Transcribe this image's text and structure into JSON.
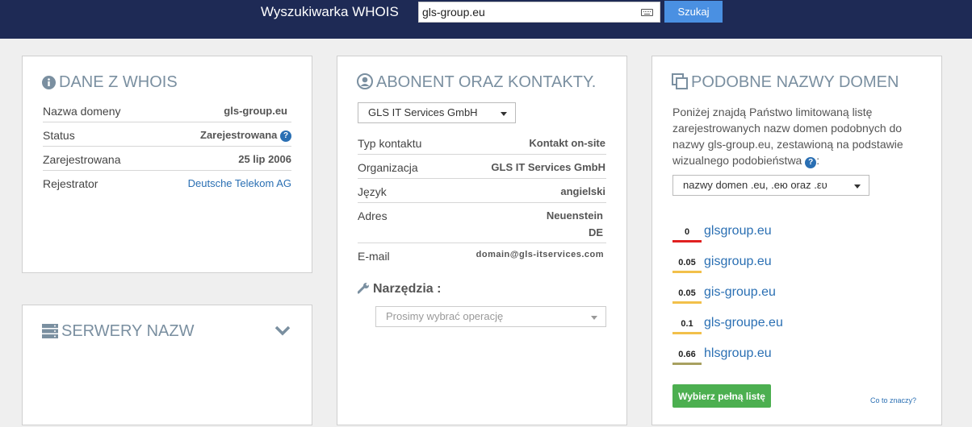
{
  "header": {
    "title": "Wyszukiwarka WHOIS",
    "search_value": "gls-group.eu",
    "search_button": "Szukaj"
  },
  "whois": {
    "title": "DANE Z WHOIS",
    "rows": [
      {
        "label": "Nazwa domeny",
        "value": "gls-group.eu"
      },
      {
        "label": "Status",
        "value": "Zarejestrowana"
      },
      {
        "label": "Zarejestrowana",
        "value": "25 lip 2006"
      },
      {
        "label": "Rejestrator",
        "value": "Deutsche Telekom AG"
      }
    ]
  },
  "servers": {
    "title": "SERWERY NAZW"
  },
  "contacts": {
    "title": "ABONENT ORAZ KONTAKTY.",
    "selected_contact": "GLS IT Services GmbH",
    "rows": [
      {
        "label": "Typ kontaktu",
        "value": "Kontakt on-site"
      },
      {
        "label": "Organizacja",
        "value": "GLS IT Services GmbH"
      },
      {
        "label": "Język",
        "value": "angielski"
      },
      {
        "label": "Adres",
        "value": "Neuenstein",
        "value2": "DE"
      },
      {
        "label": "E-mail",
        "value": "domain@gls-itservices.com"
      }
    ],
    "tools_label": "Narzędzia :",
    "tools_placeholder": "Prosimy wybrać operację"
  },
  "similar": {
    "title": "PODOBNE NAZWY DOMEN",
    "description": "Poniżej znajdą Państwo limitowaną listę zarejestrowanych nazw domen podobnych do nazwy gls-group.eu, zestawioną na podstawie wizualnego podobieństwa",
    "filter": "nazwy domen .eu, .ею oraz .ευ",
    "domains": [
      {
        "score": "0",
        "name": "glsgroup.eu",
        "color": "#e02020"
      },
      {
        "score": "0.05",
        "name": "gisgroup.eu",
        "color": "#f2c04a"
      },
      {
        "score": "0.05",
        "name": "gis-group.eu",
        "color": "#f2c04a"
      },
      {
        "score": "0.1",
        "name": "gls-groupe.eu",
        "color": "#f2c04a"
      },
      {
        "score": "0.66",
        "name": "hlsgroup.eu",
        "color": "#a8a060"
      }
    ],
    "full_list_button": "Wybierz pełną listę",
    "help_link": "Co to znaczy?"
  },
  "colors": {
    "header_bg": "#1e2a55",
    "accent_blue": "#4a90e2",
    "link": "#2a6fb3",
    "green": "#4caf50",
    "title_gray": "#7a8fa0"
  }
}
